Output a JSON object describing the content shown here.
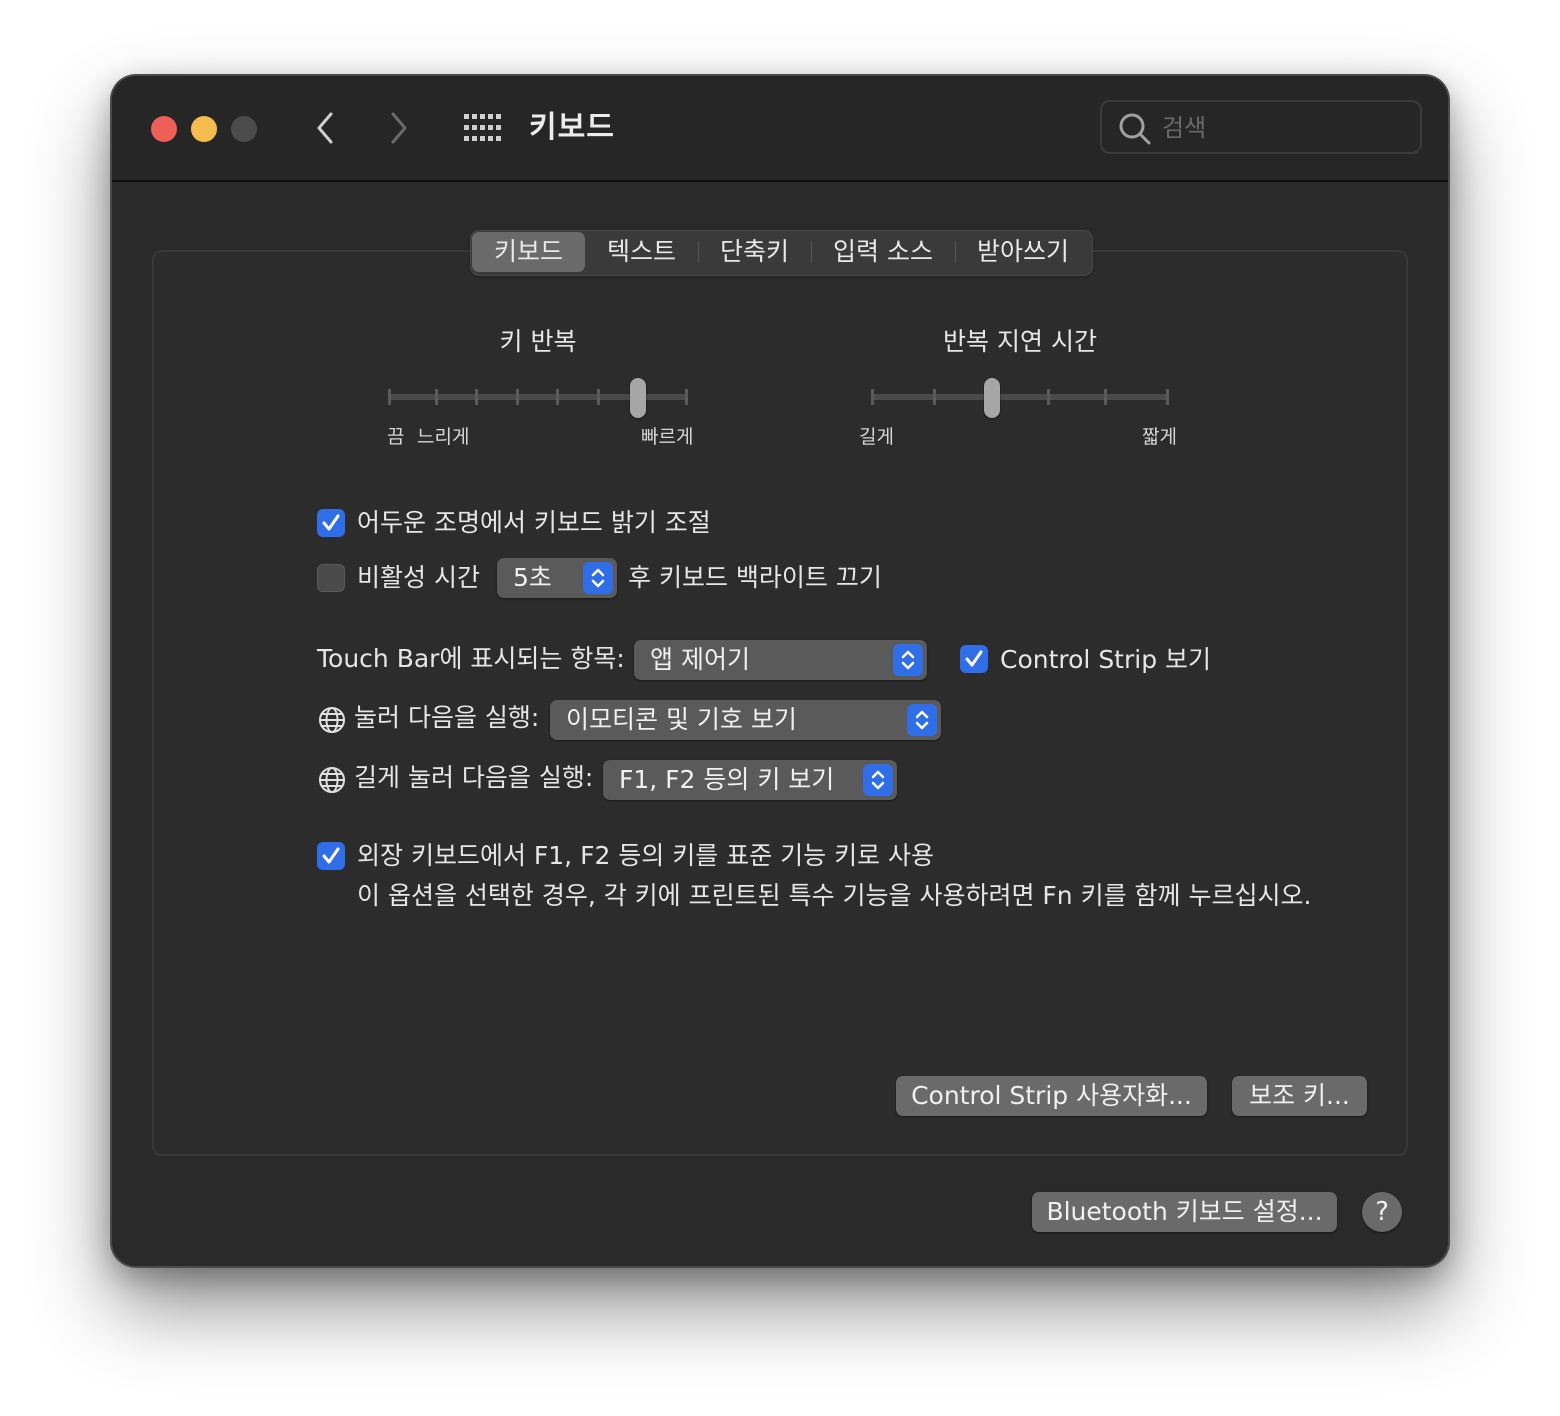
{
  "window": {
    "title": "키보드",
    "search_placeholder": "검색"
  },
  "tabs": [
    {
      "label": "키보드",
      "active": true
    },
    {
      "label": "텍스트",
      "active": false
    },
    {
      "label": "단축키",
      "active": false
    },
    {
      "label": "입력 소스",
      "active": false
    },
    {
      "label": "받아쓰기",
      "active": false
    }
  ],
  "key_repeat": {
    "title": "키 반복",
    "label_off": "끔",
    "label_slow": "느리게",
    "label_fast": "빠르게",
    "tick_count": 8,
    "selected_tick": 7
  },
  "repeat_delay": {
    "title": "반복 지연 시간",
    "label_long": "길게",
    "label_short": "짧게",
    "tick_count": 6,
    "selected_tick": 3
  },
  "options": {
    "adjust_brightness": {
      "label": "어두운 조명에서 키보드 밝기 조절",
      "checked": true
    },
    "backlight_off": {
      "label_before": "비활성 시간",
      "value": "5초",
      "label_after": "후 키보드 백라이트 끄기",
      "checked": false
    },
    "touch_bar": {
      "label": "Touch Bar에 표시되는 항목:",
      "value": "앱 제어기"
    },
    "control_strip": {
      "label": "Control Strip 보기",
      "checked": true
    },
    "press_globe": {
      "label": "눌러 다음을 실행:",
      "value": "이모티콘 및 기호 보기"
    },
    "hold_globe": {
      "label": "길게 눌러 다음을 실행:",
      "value": "F1, F2 등의 키 보기"
    },
    "standard_fn": {
      "label": "외장 키보드에서 F1, F2 등의 키를 표준 기능 키로 사용",
      "description": "이 옵션을 선택한 경우, 각 키에 프린트된 특수 기능을 사용하려면 Fn 키를 함께 누르십시오.",
      "checked": true
    }
  },
  "buttons": {
    "customize_control_strip": "Control Strip 사용자화...",
    "modifier_keys": "보조 키...",
    "bluetooth_keyboard": "Bluetooth 키보드 설정...",
    "help": "?"
  },
  "colors": {
    "accent": "#2f6ee6",
    "close": "#ee5f57",
    "minimize": "#f5bd4f",
    "maximize_disabled": "#4b4b4b"
  }
}
